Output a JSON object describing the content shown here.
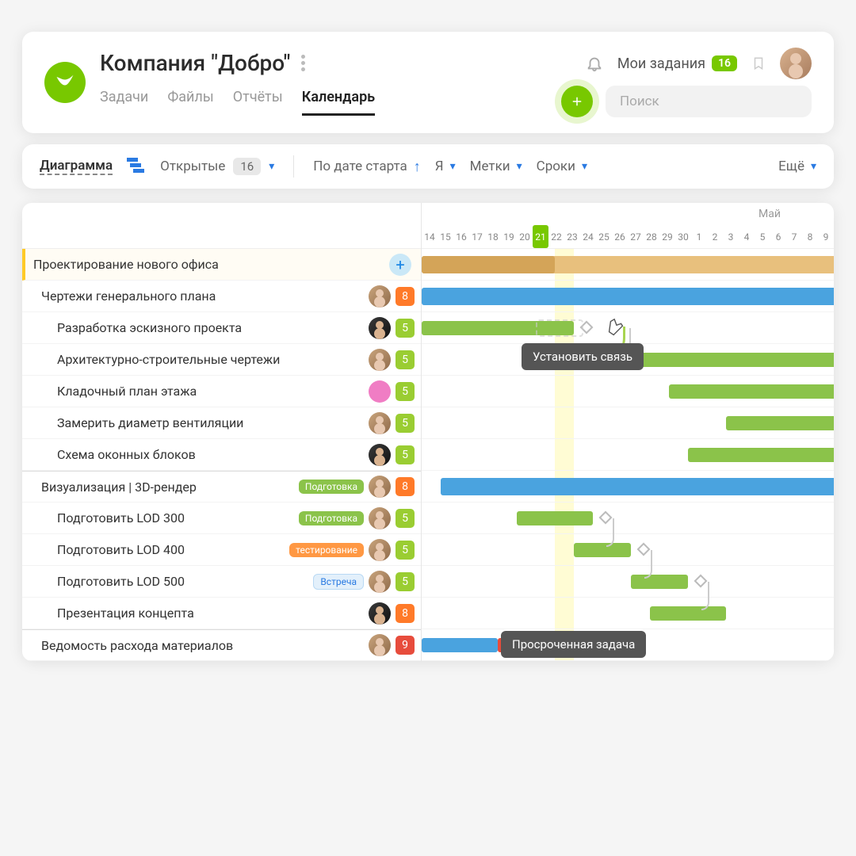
{
  "header": {
    "title": "Компания \"Добро\"",
    "tabs": [
      "Задачи",
      "Файлы",
      "Отчёты",
      "Календарь"
    ],
    "activeTab": 3,
    "myTasks": "Мои задания",
    "myTasksCount": "16",
    "searchPlaceholder": "Поиск"
  },
  "filter": {
    "diagram": "Диаграмма",
    "open": "Открытые",
    "openCount": "16",
    "sort": "По дате старта",
    "ya": "Я",
    "marks": "Метки",
    "deadlines": "Сроки",
    "more": "Ещё"
  },
  "timeline": {
    "month2": "Май",
    "days": [
      "14",
      "15",
      "16",
      "17",
      "18",
      "19",
      "20",
      "21",
      "22",
      "23",
      "24",
      "25",
      "26",
      "27",
      "28",
      "29",
      "30",
      "1",
      "2",
      "3",
      "4",
      "5",
      "6",
      "7",
      "8",
      "9"
    ],
    "todayIdx": 7
  },
  "tooltips": {
    "link": "Установить связь",
    "overdue": "Просроченная задача"
  },
  "rows": [
    {
      "name": "Проектирование нового офиса",
      "type": "header",
      "plus": true
    },
    {
      "name": "Чертежи генерального плана",
      "type": "parent",
      "av": "m1",
      "pr": "o",
      "prNum": "8"
    },
    {
      "name": "Разработка эскизного проекта",
      "type": "child",
      "av": "m2",
      "pr": "g",
      "prNum": "5"
    },
    {
      "name": "Архитектурно-строительные чертежи",
      "type": "child",
      "av": "m1",
      "pr": "g",
      "prNum": "5"
    },
    {
      "name": "Кладочный план этажа",
      "type": "child",
      "av": "pink",
      "pr": "g",
      "prNum": "5"
    },
    {
      "name": "Замерить диаметр вентиляции",
      "type": "child",
      "av": "m1",
      "pr": "g",
      "prNum": "5"
    },
    {
      "name": "Схема оконных блоков",
      "type": "child",
      "av": "m2",
      "pr": "g",
      "prNum": "5"
    },
    {
      "name": "Визуализация | 3D-рендер",
      "type": "parent",
      "section": true,
      "tag": "Подготовка",
      "tagCls": "green",
      "av": "m1",
      "pr": "o",
      "prNum": "8"
    },
    {
      "name": "Подготовить LOD 300",
      "type": "child",
      "tag": "Подготовка",
      "tagCls": "green",
      "av": "m1",
      "pr": "g",
      "prNum": "5"
    },
    {
      "name": "Подготовить LOD 400",
      "type": "child",
      "tag": "тестирование",
      "tagCls": "orange",
      "av": "m1",
      "pr": "g",
      "prNum": "5"
    },
    {
      "name": "Подготовить LOD 500",
      "type": "child",
      "tag": "Встреча",
      "tagCls": "blue",
      "av": "m1",
      "pr": "g",
      "prNum": "5"
    },
    {
      "name": "Презентация концепта",
      "type": "child",
      "av": "m2",
      "pr": "o",
      "prNum": "8"
    },
    {
      "name": "Ведомость расхода материалов",
      "type": "parent",
      "section": true,
      "av": "m1",
      "pr": "r",
      "prNum": "9"
    }
  ],
  "chart_data": {
    "type": "gantt",
    "x_unit": "day",
    "x_days": [
      "Apr 14",
      "Apr 15",
      "Apr 16",
      "Apr 17",
      "Apr 18",
      "Apr 19",
      "Apr 20",
      "Apr 21",
      "Apr 22",
      "Apr 23",
      "Apr 24",
      "Apr 25",
      "Apr 26",
      "Apr 27",
      "Apr 28",
      "Apr 29",
      "Apr 30",
      "May 1",
      "May 2",
      "May 3",
      "May 4",
      "May 5",
      "May 6",
      "May 7",
      "May 8",
      "May 9"
    ],
    "today": "Apr 21",
    "bars": [
      {
        "row": 0,
        "layers": [
          {
            "start": 0,
            "end": 26,
            "color": "#e8c07d"
          },
          {
            "start": 0,
            "end": 7,
            "color": "#d4a458"
          }
        ]
      },
      {
        "row": 1,
        "start": -1,
        "end": 26,
        "color": "#4aa3df"
      },
      {
        "row": 2,
        "start": 0,
        "end": 8,
        "color": "#8bc34a",
        "milestone_after": true
      },
      {
        "row": 3,
        "start": 11,
        "end": 26,
        "color": "#8bc34a",
        "cap_before": true,
        "milestone_before": true
      },
      {
        "row": 4,
        "start": 13,
        "end": 26,
        "color": "#8bc34a"
      },
      {
        "row": 5,
        "start": 16,
        "end": 26,
        "color": "#8bc34a"
      },
      {
        "row": 6,
        "start": 14,
        "end": 26,
        "color": "#8bc34a"
      },
      {
        "row": 7,
        "start": 1,
        "end": 26,
        "color": "#4aa3df"
      },
      {
        "row": 8,
        "start": 5,
        "end": 9,
        "color": "#8bc34a",
        "milestone_after": true
      },
      {
        "row": 9,
        "start": 8,
        "end": 11,
        "color": "#8bc34a",
        "milestone_after": true
      },
      {
        "row": 10,
        "start": 11,
        "end": 14,
        "color": "#8bc34a",
        "milestone_after": true
      },
      {
        "row": 11,
        "start": 12,
        "end": 16,
        "color": "#8bc34a"
      },
      {
        "row": 12,
        "start": 0,
        "end": 4,
        "color": "#4aa3df",
        "overdue_extension": {
          "start": 4,
          "end": 8
        }
      }
    ],
    "dependencies": [
      [
        2,
        3
      ],
      [
        3,
        4
      ],
      [
        4,
        5
      ],
      [
        8,
        9
      ],
      [
        9,
        10
      ],
      [
        10,
        11
      ]
    ]
  }
}
